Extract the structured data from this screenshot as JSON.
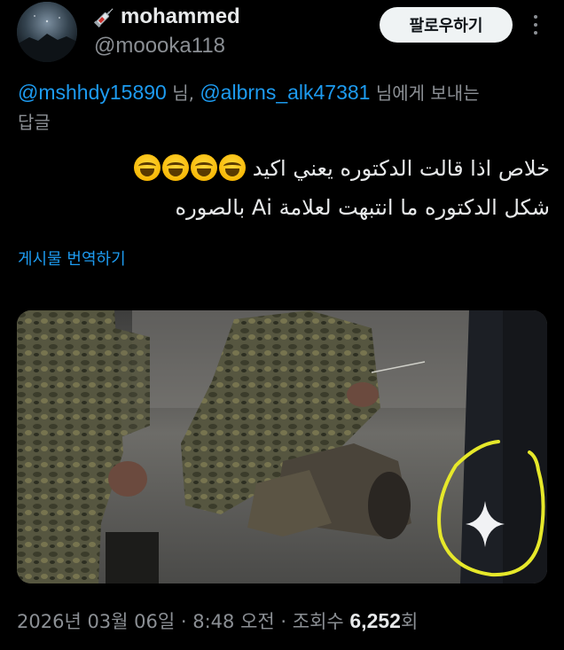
{
  "header": {
    "display_name": "mohammed",
    "name_emoji_icon": "syringe-icon",
    "handle": "@moooka118",
    "follow_label": "팔로우하기",
    "more_icon": "more-vertical-icon"
  },
  "reply": {
    "mention_1": "@mshhdy15890",
    "sep_1": " 님, ",
    "mention_2": "@albrns_alk47381",
    "suffix": " 님에게 보내는",
    "line2": "답글"
  },
  "tweet": {
    "line1_text": "خلاص اذا قالت الدكتوره يعني اكيد",
    "line1_emoji": "grinning-squinting-face-emoji",
    "line1_emoji_count": 4,
    "line2_text": "شكل الدكتوره ما انتبهت لعلامة Ai بالصوره"
  },
  "translate_link": "게시물 번역하기",
  "media": {
    "description_icon": "photo-image",
    "highlight_color": "#e6e82a"
  },
  "footer": {
    "date": "2026년 03월 06일",
    "sep_1": " · ",
    "time": "8:48 오전",
    "sep_2": " · ",
    "views_prefix": "조회수 ",
    "views": "6,252",
    "views_suffix": "회"
  },
  "colors": {
    "background": "#000000",
    "text": "#e7e9ea",
    "secondary": "#8b8f94",
    "accent": "#1d9bf0",
    "follow_bg": "#eff3f4"
  }
}
